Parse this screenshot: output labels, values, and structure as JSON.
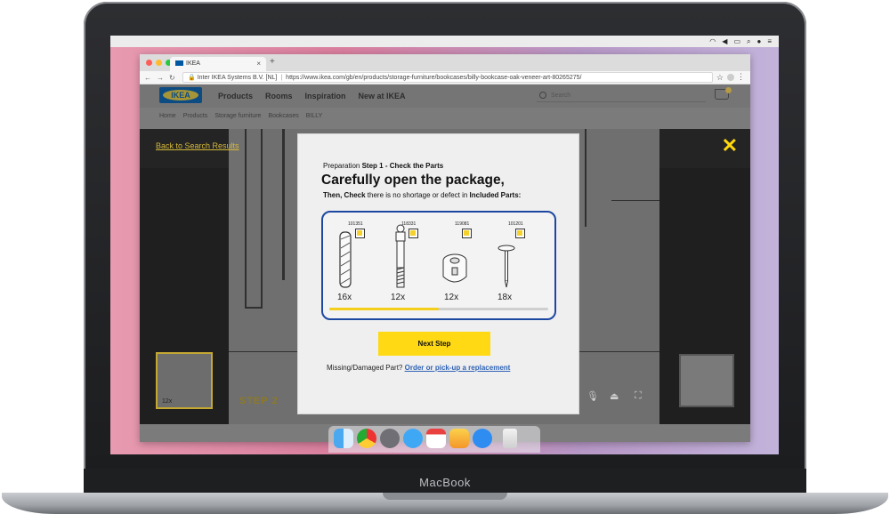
{
  "device": {
    "brand": "MacBook"
  },
  "browser": {
    "tab_title": "IKEA",
    "tab_close": "×",
    "new_tab": "+",
    "nav_icons": [
      "back-icon",
      "forward-icon",
      "reload-icon"
    ],
    "site_identity": "Inter IKEA Systems B.V. [NL]",
    "url": "https://www.ikea.com/gb/en/products/storage-furniture/bookcases/billy-bookcase-oak-veneer-art-80265275/"
  },
  "site": {
    "logo_text": "IKEA",
    "nav": [
      "Products",
      "Rooms",
      "Inspiration",
      "New at IKEA"
    ],
    "search_placeholder": "Search",
    "breadcrumb": [
      "Home",
      "Products",
      "Storage furniture",
      "Bookcases",
      "BILLY"
    ]
  },
  "viewer": {
    "back_link": "Back to Search Results",
    "close": "✕",
    "step_label": "STEP 2",
    "thumb_label": "12x",
    "controls": [
      "microphone-icon",
      "airplay-icon",
      "fullscreen-icon"
    ]
  },
  "modal": {
    "prep_prefix": "Preparation",
    "prep_step": "Step 1 - Check the Parts",
    "heading": "Carefully open the package,",
    "sub_bold1": "Then, Check",
    "sub_mid": " there is no shortage or defect in ",
    "sub_bold2": "Included Parts:",
    "parts": [
      {
        "code": "101351",
        "qty": "16x",
        "icon": "dowel-icon"
      },
      {
        "code": "118331",
        "qty": "12x",
        "icon": "connector-bolt-icon"
      },
      {
        "code": "119081",
        "qty": "12x",
        "icon": "cam-lock-icon"
      },
      {
        "code": "101201",
        "qty": "18x",
        "icon": "nail-icon"
      }
    ],
    "progress": 0.5,
    "next_button": "Next Step",
    "missing_text": "Missing/Damaged Part?",
    "missing_link": "Order or pick-up a replacement"
  },
  "dock": [
    "finder-icon",
    "chrome-icon",
    "system-preferences-icon",
    "messages-icon",
    "calendar-icon",
    "sketch-icon",
    "safari-icon",
    "trash-icon"
  ],
  "colors": {
    "ikea_blue": "#0058a3",
    "ikea_yellow": "#ffd914",
    "parts_border": "#1d48a1",
    "link": "#2f63b5"
  }
}
